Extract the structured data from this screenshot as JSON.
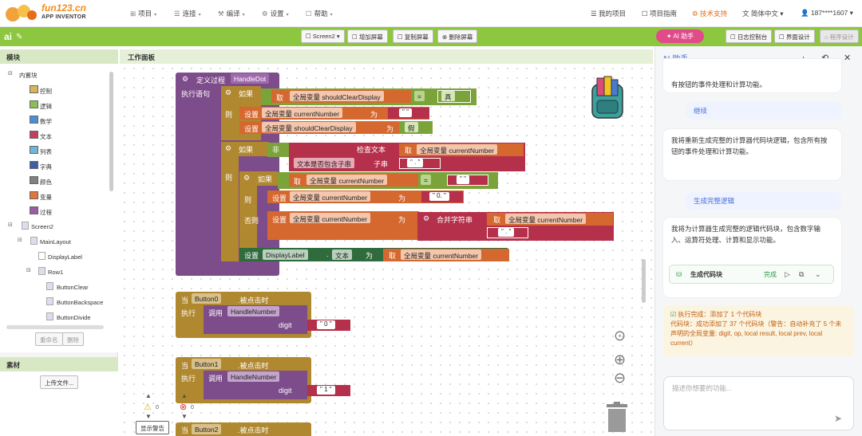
{
  "app": {
    "logo_line1": "fun123.cn",
    "logo_line2": "APP INVENTOR",
    "project_name": "ai"
  },
  "top_menu": [
    {
      "icon": "⊞",
      "label": "项目"
    },
    {
      "icon": "☰",
      "label": "连接"
    },
    {
      "icon": "⚒",
      "label": "编译"
    },
    {
      "icon": "⚙",
      "label": "设置"
    },
    {
      "icon": "☐",
      "label": "帮助"
    }
  ],
  "top_right": {
    "my_projects": "我的项目",
    "guide": "项目指南",
    "support": "技术支持",
    "language": "简体中文",
    "account": "187****1607"
  },
  "toolbar": {
    "screen": "Screen2",
    "add_screen": "增加屏幕",
    "copy_screen": "复制屏幕",
    "delete_screen": "删除屏幕",
    "ai_button": "AI 助手",
    "log": "日志控制台",
    "designer": "界面设计",
    "blocks": "程序设计"
  },
  "left": {
    "modules_title": "模块",
    "builtin": "内置块",
    "builtins": [
      "控制",
      "逻辑",
      "数学",
      "文本",
      "列表",
      "字典",
      "颜色",
      "变量",
      "过程"
    ],
    "screen": "Screen2",
    "components": [
      "MainLayout",
      "DisplayLabel",
      "Row1",
      "ButtonClear",
      "ButtonBackspace",
      "ButtonDivide"
    ],
    "rename": "重命名",
    "delete": "删除",
    "media_title": "素材",
    "upload": "上传文件..."
  },
  "workspace": {
    "title": "工作面板",
    "proc": {
      "define": "定义过程",
      "name": "HandleDot",
      "exec": "执行语句",
      "if": "如果",
      "then": "则",
      "else": "否则",
      "not": "非",
      "get": "取",
      "global_should": "全局变量 shouldClearDisplay",
      "global_cur": "全局变量 currentNumber",
      "eq": "=",
      "true": "真",
      "false": "假",
      "set": "设置",
      "to": "为",
      "empty": "\" \"",
      "check_text": "检查文本",
      "contains": "文本是否包含子串",
      "substring": "子串",
      "dot_str": "\" . \"",
      "zero_dot": "\" 0. \"",
      "join": "合并字符串",
      "display_label": "DisplayLabel",
      "text_prop": "文本"
    },
    "events": [
      {
        "when": "当",
        "component": "Button0",
        "click": ".被点击时",
        "exec": "执行",
        "call": "调用",
        "proc": "HandleNumber",
        "param": "digit",
        "value": "\" 0 \""
      },
      {
        "when": "当",
        "component": "Button1",
        "click": ".被点击时",
        "exec": "执行",
        "call": "调用",
        "proc": "HandleNumber",
        "param": "digit",
        "value": "\" 1 \""
      },
      {
        "when": "当",
        "component": "Button2",
        "click": ".被点击时"
      }
    ],
    "warnings": {
      "warn_count": "0",
      "error_count": "0",
      "show_warnings": "显示警告"
    }
  },
  "assistant": {
    "title": "AI 助手",
    "messages": [
      {
        "role": "ai",
        "text": "有按钮的事件处理和计算功能。"
      },
      {
        "role": "user",
        "text": "继续"
      },
      {
        "role": "ai",
        "text": "我将重新生成完整的计算器代码块逻辑，包含所有按钮的事件处理和计算功能。"
      },
      {
        "role": "user",
        "text": "生成完整逻辑"
      },
      {
        "role": "ai",
        "text": "我将为计算器生成完整的逻辑代码块，包含数字输入、运算符处理、计算和显示功能。"
      }
    ],
    "code_card": {
      "label": "生成代码块",
      "status": "完成"
    },
    "result": {
      "line1": "执行完成：添加了 1 个代码块",
      "line2": "代码块：成功添加了 37 个代码块（警告：自动补充了 5 个未声明的全局变量: digit, op, local result, local prev, local current）"
    },
    "input_placeholder": "描述你想要的功能..."
  },
  "colors": {
    "accent_green": "#8dc63f",
    "procedure": "#7d4c8a",
    "control": "#b08830",
    "logic": "#7aa33a",
    "variable": "#d5682f",
    "text": "#b5304a",
    "component": "#2f6b3d",
    "ai_pink": "#e14b8a",
    "orange": "#e86c17"
  }
}
